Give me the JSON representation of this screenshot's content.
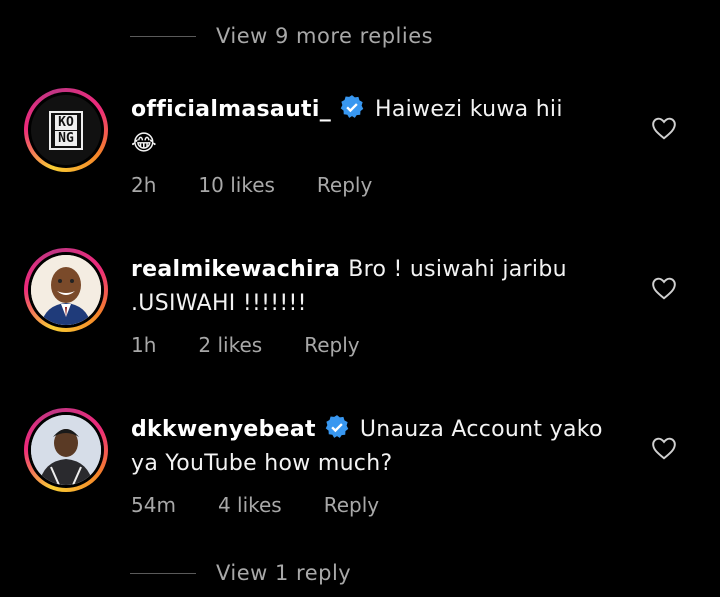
{
  "replies_top": {
    "label": "View 9 more replies"
  },
  "comments": [
    {
      "username": "officialmasauti_",
      "verified": true,
      "text": "Haiwezi kuwa hii",
      "emoji": "😂",
      "time": "2h",
      "likes": "10 likes",
      "reply": "Reply",
      "avatar_text_1": "KO",
      "avatar_text_2": "NG"
    },
    {
      "username": "realmikewachira",
      "verified": false,
      "text": "Bro ! usiwahi jaribu .USIWAHI !!!!!!!",
      "time": "1h",
      "likes": "2 likes",
      "reply": "Reply"
    },
    {
      "username": "dkkwenyebeat",
      "verified": true,
      "text": "Unauza Account yako ya YouTube how much?",
      "time": "54m",
      "likes": "4 likes",
      "reply": "Reply"
    }
  ],
  "replies_bottom": {
    "label": "View 1 reply"
  },
  "colors": {
    "background": "#000000",
    "verified": "#3897f0",
    "muted": "#a8a8a8"
  }
}
